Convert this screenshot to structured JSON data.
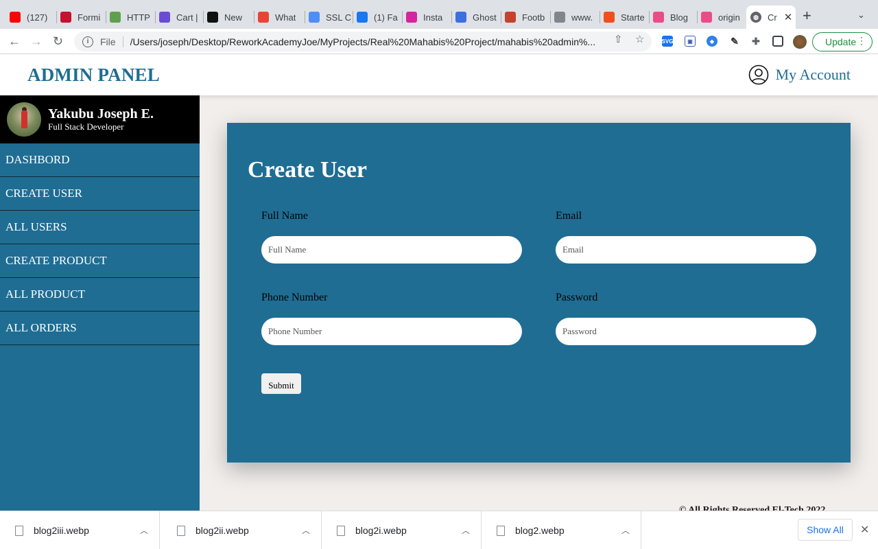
{
  "browser": {
    "tabs": [
      {
        "title": "(127)",
        "icon": "youtube-icon",
        "color": "#ff0000"
      },
      {
        "title": "Formi",
        "icon": "formik-icon",
        "color": "#c4122f"
      },
      {
        "title": "HTTP",
        "icon": "node-icon",
        "color": "#5fa04e"
      },
      {
        "title": "Cart |",
        "icon": "hotjar-icon",
        "color": "#6a4bd8"
      },
      {
        "title": "New",
        "icon": "vercel-icon",
        "color": "#111111"
      },
      {
        "title": "What",
        "icon": "error-icon",
        "color": "#ea4335"
      },
      {
        "title": "SSL C",
        "icon": "shield-icon",
        "color": "#4f8ef7"
      },
      {
        "title": "(1) Fa",
        "icon": "facebook-icon",
        "color": "#1877f2"
      },
      {
        "title": "Insta",
        "icon": "instagram-icon",
        "color": "#d6249f"
      },
      {
        "title": "Ghost",
        "icon": "ghost-icon",
        "color": "#3d6fe0"
      },
      {
        "title": "Footb",
        "icon": "football-icon",
        "color": "#c7402d"
      },
      {
        "title": "www.",
        "icon": "globe-icon",
        "color": "#80868b"
      },
      {
        "title": "Starte",
        "icon": "figma-icon",
        "color": "#f24e1e"
      },
      {
        "title": "Blog",
        "icon": "dribbble-icon",
        "color": "#ea4c89"
      },
      {
        "title": "origin",
        "icon": "dribbble-icon",
        "color": "#ea4c89"
      }
    ],
    "active_tab": {
      "title": "Cr",
      "icon": "globe-icon"
    },
    "address": {
      "scheme": "File",
      "url": "/Users/joseph/Desktop/ReworkAcademyJoe/MyProjects/Real%20Mahabis%20Project/mahabis%20admin%..."
    },
    "update_label": "Update"
  },
  "header": {
    "brand": "ADMIN PANEL",
    "account_label": "My Account"
  },
  "profile": {
    "name": "Yakubu Joseph E.",
    "role": "Full Stack Developer"
  },
  "menu": [
    {
      "label": "DASHBORD"
    },
    {
      "label": "CREATE USER"
    },
    {
      "label": "ALL USERS"
    },
    {
      "label": "CREATE PRODUCT"
    },
    {
      "label": "ALL PRODUCT"
    },
    {
      "label": "ALL ORDERS"
    }
  ],
  "form": {
    "title": "Create User",
    "full_name": {
      "label": "Full Name",
      "placeholder": "Full Name",
      "value": ""
    },
    "email": {
      "label": "Email",
      "placeholder": "Email",
      "value": ""
    },
    "phone": {
      "label": "Phone Number",
      "placeholder": "Phone Number",
      "value": ""
    },
    "password": {
      "label": "Password",
      "placeholder": "Password",
      "value": ""
    },
    "submit_label": "Submit"
  },
  "footer": {
    "text": "© All Rights Reserved El-Tech 2022"
  },
  "downloads": {
    "items": [
      {
        "filename": "blog2iii.webp"
      },
      {
        "filename": "blog2ii.webp"
      },
      {
        "filename": "blog2i.webp"
      },
      {
        "filename": "blog2.webp"
      }
    ],
    "show_all_label": "Show All"
  },
  "colors": {
    "primary": "#1f6d93",
    "profile_bg": "#000000",
    "page_bg": "#f1eeec"
  }
}
